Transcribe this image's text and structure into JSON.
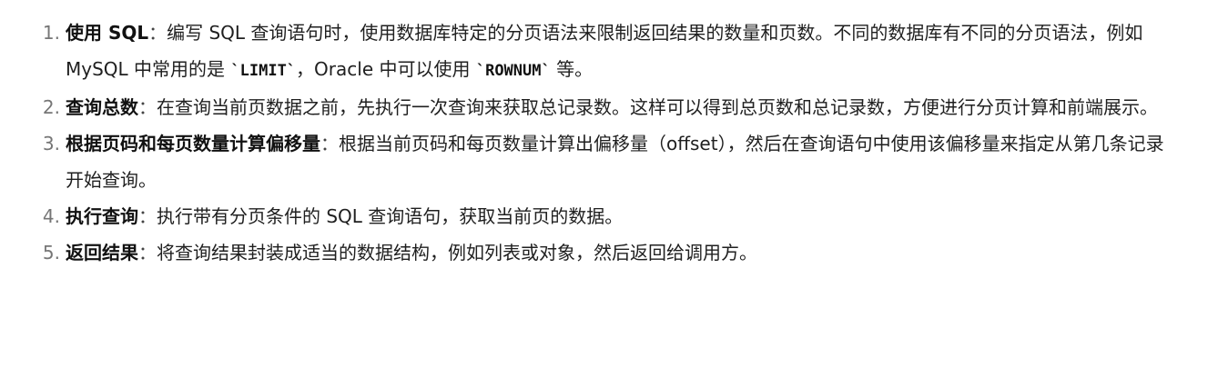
{
  "steps": [
    {
      "number": "1.",
      "title": "使用 SQL",
      "sep": "：",
      "text_a": "编写 SQL 查询语句时，使用数据库特定的分页语法来限制返回结果的数量和页数。不同的数据库有不同的分页语法，例如 MySQL 中常用的是 ",
      "code_a": "`LIMIT`",
      "text_b": "，Oracle 中可以使用 ",
      "code_b": "`ROWNUM`",
      "text_c": " 等。"
    },
    {
      "number": "2.",
      "title": "查询总数",
      "sep": "：",
      "text": "在查询当前页数据之前，先执行一次查询来获取总记录数。这样可以得到总页数和总记录数，方便进行分页计算和前端展示。"
    },
    {
      "number": "3.",
      "title": "根据页码和每页数量计算偏移量",
      "sep": "：",
      "text": "根据当前页码和每页数量计算出偏移量（offset），然后在查询语句中使用该偏移量来指定从第几条记录开始查询。"
    },
    {
      "number": "4.",
      "title": "执行查询",
      "sep": "：",
      "text": "执行带有分页条件的 SQL 查询语句，获取当前页的数据。"
    },
    {
      "number": "5.",
      "title": "返回结果",
      "sep": "：",
      "text": "将查询结果封装成适当的数据结构，例如列表或对象，然后返回给调用方。"
    }
  ]
}
